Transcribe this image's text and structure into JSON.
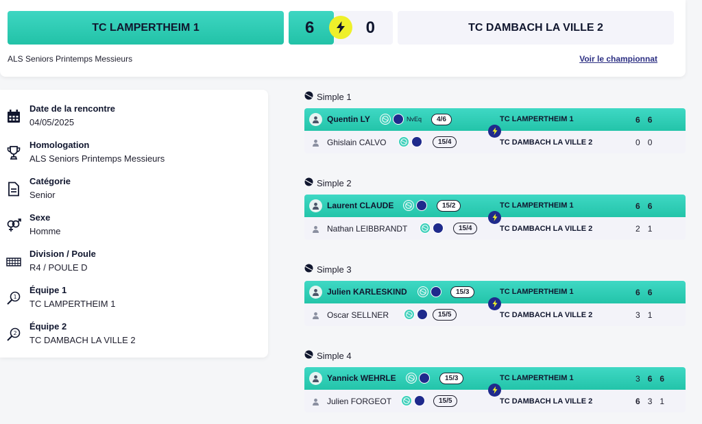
{
  "header": {
    "home_team": "TC LAMPERTHEIM 1",
    "home_score": "6",
    "away_score": "0",
    "away_team": "TC DAMBACH LA VILLE 2",
    "competition": "ALS Seniors Printemps Messieurs",
    "championship_link": "Voir le championnat"
  },
  "info": [
    {
      "label": "Date de la rencontre",
      "value": "04/05/2025",
      "icon": "calendar-icon"
    },
    {
      "label": "Homologation",
      "value": "ALS Seniors Printemps Messieurs",
      "icon": "trophy-icon"
    },
    {
      "label": "Catégorie",
      "value": "Senior",
      "icon": "document-icon"
    },
    {
      "label": "Sexe",
      "value": "Homme",
      "icon": "gender-icon"
    },
    {
      "label": "Division / Poule",
      "value": "R4 / POULE D",
      "icon": "grid-icon"
    },
    {
      "label": "Équipe 1",
      "value": "TC LAMPERTHEIM 1",
      "icon": "racket-1-icon"
    },
    {
      "label": "Équipe 2",
      "value": "TC DAMBACH LA VILLE 2",
      "icon": "racket-2-icon"
    }
  ],
  "matches": [
    {
      "title": "Simple 1",
      "winner": {
        "name": "Quentin LY",
        "nveq": "NvEq",
        "rank": "4/6",
        "team": "TC LAMPERTHEIM 1",
        "sets": [
          "6",
          "6"
        ]
      },
      "loser": {
        "name": "Ghislain CALVO",
        "rank": "15/4",
        "team": "TC DAMBACH LA VILLE 2",
        "sets": [
          "0",
          "0"
        ]
      }
    },
    {
      "title": "Simple 2",
      "winner": {
        "name": "Laurent CLAUDE",
        "rank": "15/2",
        "team": "TC LAMPERTHEIM 1",
        "sets": [
          "6",
          "6"
        ]
      },
      "loser": {
        "name": "Nathan LEIBBRANDT",
        "rank": "15/4",
        "team": "TC DAMBACH LA VILLE 2",
        "sets": [
          "2",
          "1"
        ]
      }
    },
    {
      "title": "Simple 3",
      "winner": {
        "name": "Julien KARLESKIND",
        "rank": "15/3",
        "team": "TC LAMPERTHEIM 1",
        "sets": [
          "6",
          "6"
        ]
      },
      "loser": {
        "name": "Oscar SELLNER",
        "rank": "15/5",
        "team": "TC DAMBACH LA VILLE 2",
        "sets": [
          "3",
          "1"
        ]
      }
    },
    {
      "title": "Simple 4",
      "winner": {
        "name": "Yannick WEHRLE",
        "rank": "15/3",
        "team": "TC LAMPERTHEIM 1",
        "sets": [
          "3",
          "6",
          "6"
        ]
      },
      "loser": {
        "name": "Julien FORGEOT",
        "rank": "15/5",
        "team": "TC DAMBACH LA VILLE 2",
        "sets": [
          "6",
          "3",
          "1"
        ]
      }
    }
  ],
  "colors": {
    "accent": "#22c2a7",
    "navy": "#1f2a8c",
    "bolt": "#eef02a"
  }
}
